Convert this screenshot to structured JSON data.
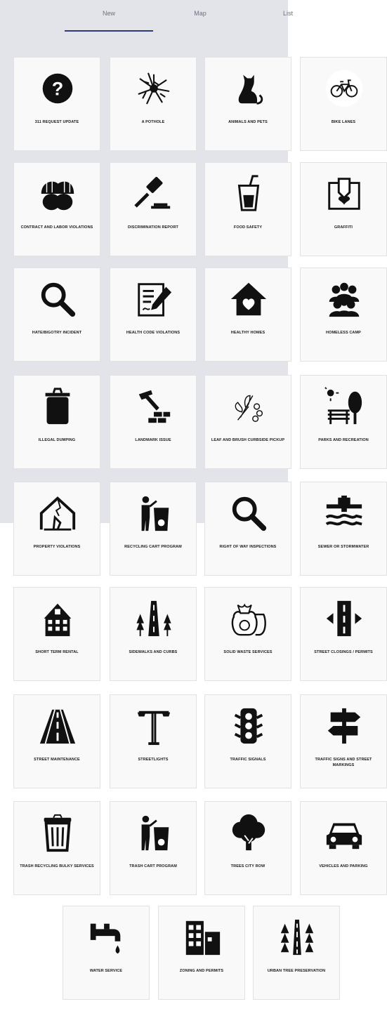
{
  "tabs": [
    {
      "label": "New",
      "selected": true
    },
    {
      "label": "Map",
      "selected": false
    },
    {
      "label": "List",
      "selected": false
    }
  ],
  "colors": {
    "accent": "#2c3a7a",
    "panel": "#e3e4e9",
    "tile_bg": "#f9f9f9",
    "icon": "#111111"
  },
  "tiles": [
    {
      "label": "311 REQUEST UPDATE",
      "icon": "question-circle-icon"
    },
    {
      "label": "A POTHOLE",
      "icon": "pothole-crack-icon"
    },
    {
      "label": "ANIMALS AND PETS",
      "icon": "cat-icon"
    },
    {
      "label": "BIKE LANES",
      "icon": "bicycle-icon"
    },
    {
      "label": "CONTRACT AND LABOR VIOLATIONS",
      "icon": "hard-hats-icon"
    },
    {
      "label": "DISCRIMINATION REPORT",
      "icon": "gavel-icon"
    },
    {
      "label": "FOOD SAFETY",
      "icon": "drink-cup-icon"
    },
    {
      "label": "GRAFFITI",
      "icon": "spray-wall-icon"
    },
    {
      "label": "HATE/BIGOTRY INCIDENT",
      "icon": "magnifier-icon"
    },
    {
      "label": "HEALTH CODE VIOLATIONS",
      "icon": "document-pen-icon"
    },
    {
      "label": "HEALTHY HOMES",
      "icon": "house-heart-icon"
    },
    {
      "label": "HOMELESS CAMP",
      "icon": "people-group-icon"
    },
    {
      "label": "ILLEGAL DUMPING",
      "icon": "trash-can-icon"
    },
    {
      "label": "LANDMARK ISSUE",
      "icon": "hammer-bricks-icon"
    },
    {
      "label": "LEAF AND BRUSH CURBSIDE PICKUP",
      "icon": "leaves-icon"
    },
    {
      "label": "PARKS AND RECREATION",
      "icon": "park-bench-icon"
    },
    {
      "label": "PROPERTY VIOLATIONS",
      "icon": "broken-house-icon"
    },
    {
      "label": "RECYCLING CART PROGRAM",
      "icon": "recycle-bin-person-icon"
    },
    {
      "label": "RIGHT OF WAY INSPECTIONS",
      "icon": "magnifier-icon"
    },
    {
      "label": "SEWER OR STORMWATER",
      "icon": "sewer-pipe-icon"
    },
    {
      "label": "SHORT TERM RENTAL",
      "icon": "building-icon"
    },
    {
      "label": "SIDEWALKS AND CURBS",
      "icon": "road-trees-icon"
    },
    {
      "label": "SOLID WASTE SERVICES",
      "icon": "garbage-bags-icon"
    },
    {
      "label": "STREET CLOSINGS / PERMITS",
      "icon": "road-arrows-icon"
    },
    {
      "label": "STREET MAINTENANCE",
      "icon": "road-icon"
    },
    {
      "label": "STREETLIGHTS",
      "icon": "streetlight-icon"
    },
    {
      "label": "TRAFFIC SIGNALS",
      "icon": "traffic-light-icon"
    },
    {
      "label": "TRAFFIC SIGNS AND STREET MARKINGS",
      "icon": "signpost-icon"
    },
    {
      "label": "TRASH RECYCLING BULKY SERVICES",
      "icon": "trash-bin-icon"
    },
    {
      "label": "TRASH CART PROGRAM",
      "icon": "recycle-bin-person-icon"
    },
    {
      "label": "TREES CITY ROW",
      "icon": "tree-icon"
    },
    {
      "label": "VEHICLES AND PARKING",
      "icon": "car-icon"
    },
    {
      "label": "WATER SERVICE",
      "icon": "faucet-icon"
    },
    {
      "label": "ZONING AND PERMITS",
      "icon": "buildings-icon"
    },
    {
      "label": "URBAN TREE PRESERVATION",
      "icon": "tree-road-icon"
    }
  ]
}
